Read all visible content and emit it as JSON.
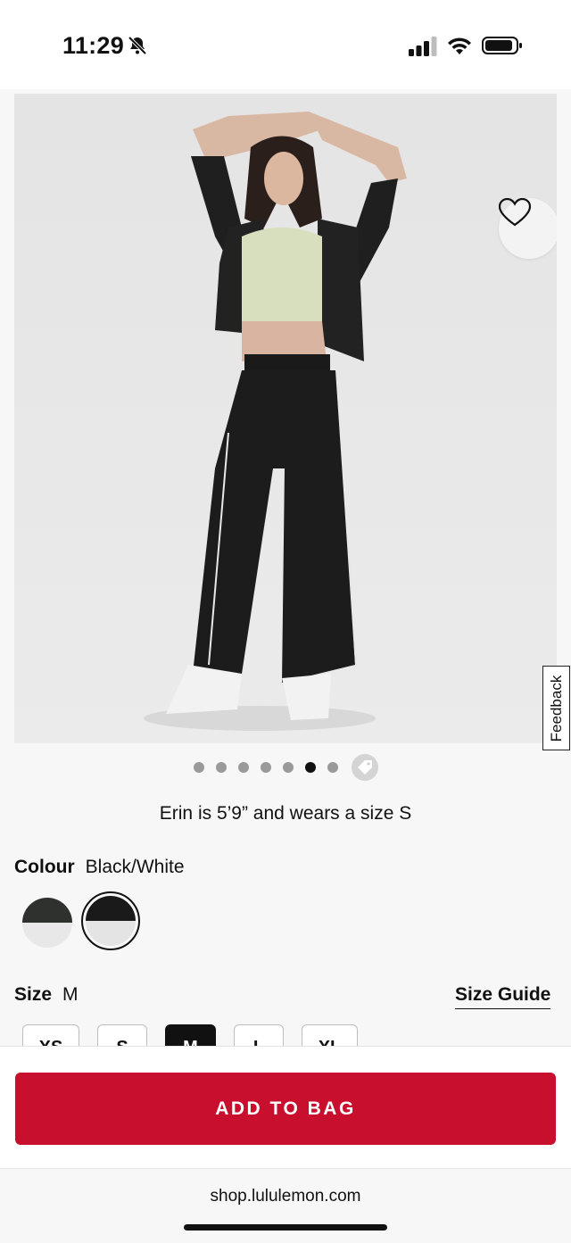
{
  "status_bar": {
    "time": "11:29"
  },
  "product": {
    "model_note": "Erin is 5’9” and wears a size S",
    "gallery": {
      "total_images": 7,
      "active_index": 5
    }
  },
  "colour": {
    "label": "Colour",
    "selected": "Black/White",
    "swatches": [
      {
        "name": "swatch-1",
        "top": "#2f312e",
        "bottom": "#e8e8e8"
      },
      {
        "name": "swatch-2",
        "top": "#1a1a1a",
        "bottom": "#e4e4e4"
      }
    ]
  },
  "size": {
    "label": "Size",
    "selected": "M",
    "guide_label": "Size Guide",
    "options": [
      "XS",
      "S",
      "M",
      "L",
      "XL"
    ]
  },
  "cta": {
    "add_to_bag": "ADD TO BAG"
  },
  "feedback": {
    "label": "Feedback"
  },
  "browser": {
    "url": "shop.lululemon.com"
  },
  "colors": {
    "brand_red": "#c8102e",
    "selected_dot": "#111111",
    "dot": "#9a9a9a"
  }
}
